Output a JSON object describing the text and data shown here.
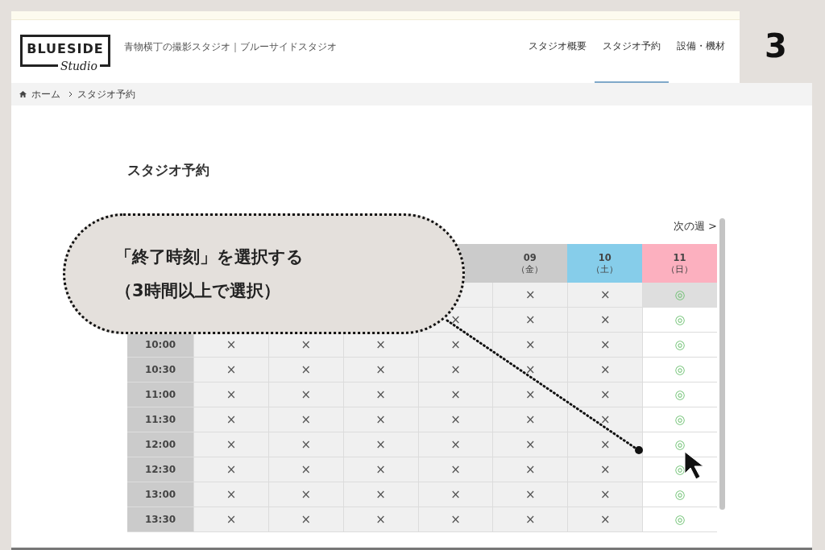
{
  "step_number": "3",
  "header": {
    "logo": {
      "name": "BLUESIDE",
      "sub": "Studio"
    },
    "tagline": "青物横丁の撮影スタジオ｜ブルーサイドスタジオ",
    "nav": [
      {
        "label": "スタジオ概要",
        "selected": false
      },
      {
        "label": "スタジオ予約",
        "selected": true
      },
      {
        "label": "設備・機材",
        "selected": false
      }
    ]
  },
  "breadcrumb": [
    "ホーム",
    "スタジオ予約"
  ],
  "page_title": "スタジオ予約",
  "next_week": "次の週 >",
  "table": {
    "columns": [
      {
        "kind": "weekday"
      },
      {
        "kind": "weekday"
      },
      {
        "kind": "weekday"
      },
      {
        "kind": "weekday"
      },
      {
        "kind": "weekday",
        "date": "09",
        "weekday": "（金）"
      },
      {
        "kind": "saturday",
        "date": "10",
        "weekday": "（土）"
      },
      {
        "kind": "sunday",
        "date": "11",
        "weekday": "（日）"
      }
    ],
    "rows": [
      {
        "selected": true,
        "cells": [
          null,
          null,
          null,
          null,
          "×",
          "×",
          "◎"
        ]
      },
      {
        "selected": false,
        "cells": [
          null,
          null,
          null,
          "×",
          "×",
          "×",
          "◎"
        ]
      },
      {
        "time": "10:00",
        "selected": false,
        "cells": [
          "×",
          "×",
          "×",
          "×",
          "×",
          "×",
          "◎"
        ]
      },
      {
        "time": "10:30",
        "selected": false,
        "cells": [
          "×",
          "×",
          "×",
          "×",
          "×",
          "×",
          "◎"
        ]
      },
      {
        "time": "11:00",
        "selected": false,
        "cells": [
          "×",
          "×",
          "×",
          "×",
          "×",
          "×",
          "◎"
        ]
      },
      {
        "time": "11:30",
        "selected": false,
        "cells": [
          "×",
          "×",
          "×",
          "×",
          "×",
          "×",
          "◎"
        ]
      },
      {
        "time": "12:00",
        "selected": false,
        "cells": [
          "×",
          "×",
          "×",
          "×",
          "×",
          "×",
          "◎"
        ]
      },
      {
        "time": "12:30",
        "selected": false,
        "cells": [
          "×",
          "×",
          "×",
          "×",
          "×",
          "×",
          "◎"
        ]
      },
      {
        "time": "13:00",
        "selected": false,
        "cells": [
          "×",
          "×",
          "×",
          "×",
          "×",
          "×",
          "◎"
        ]
      },
      {
        "time": "13:30",
        "selected": false,
        "cells": [
          "×",
          "×",
          "×",
          "×",
          "×",
          "×",
          "◎"
        ]
      }
    ]
  },
  "callout": {
    "lines": [
      "「終了時刻」を選択する",
      "（3時間以上で選択）"
    ]
  }
}
